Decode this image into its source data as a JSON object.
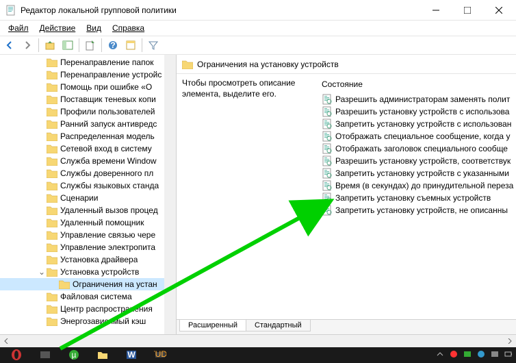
{
  "window": {
    "title": "Редактор локальной групповой политики"
  },
  "menu": {
    "file": "Файл",
    "action": "Действие",
    "view": "Вид",
    "help": "Справка"
  },
  "tree": {
    "items": [
      {
        "label": "Перенаправление папок",
        "level": 0
      },
      {
        "label": "Перенаправление устройс",
        "level": 0
      },
      {
        "label": "Помощь при ошибке «О",
        "level": 0
      },
      {
        "label": "Поставщик теневых копи",
        "level": 0
      },
      {
        "label": "Профили пользователей",
        "level": 0
      },
      {
        "label": "Ранний запуск антивредс",
        "level": 0
      },
      {
        "label": "Распределенная модель",
        "level": 0
      },
      {
        "label": "Сетевой вход в систему",
        "level": 0
      },
      {
        "label": "Служба времени Window",
        "level": 0
      },
      {
        "label": "Службы доверенного пл",
        "level": 0
      },
      {
        "label": "Службы языковых станда",
        "level": 0
      },
      {
        "label": "Сценарии",
        "level": 0
      },
      {
        "label": "Удаленный вызов процед",
        "level": 0
      },
      {
        "label": "Удаленный помощник",
        "level": 0
      },
      {
        "label": "Управление связью чере",
        "level": 0
      },
      {
        "label": "Управление электропита",
        "level": 0
      },
      {
        "label": "Установка драйвера",
        "level": 0
      },
      {
        "label": "Установка устройств",
        "level": 0,
        "expanded": true
      },
      {
        "label": "Ограничения на устан",
        "level": 1,
        "selected": true
      },
      {
        "label": "Файловая система",
        "level": 0
      },
      {
        "label": "Центр распространения",
        "level": 0
      },
      {
        "label": "Энергозависимый кэш",
        "level": 0
      }
    ]
  },
  "detail": {
    "title": "Ограничения на установку устройств",
    "description": "Чтобы просмотреть описание элемента, выделите его.",
    "column_state": "Состояние",
    "policies": [
      "Разрешить администраторам заменять полит",
      "Разрешить установку устройств с использова",
      "Запретить установку устройств с использован",
      "Отображать специальное сообщение, когда у",
      "Отображать заголовок специального сообще",
      "Разрешить установку устройств, соответствук",
      "Запретить установку устройств с указанными",
      "Время (в секундах) до принудительной переза",
      "Запретить установку съемных устройств",
      "Запретить установку устройств, не описанны"
    ]
  },
  "tabs": {
    "extended": "Расширенный",
    "standard": "Стандартный"
  }
}
